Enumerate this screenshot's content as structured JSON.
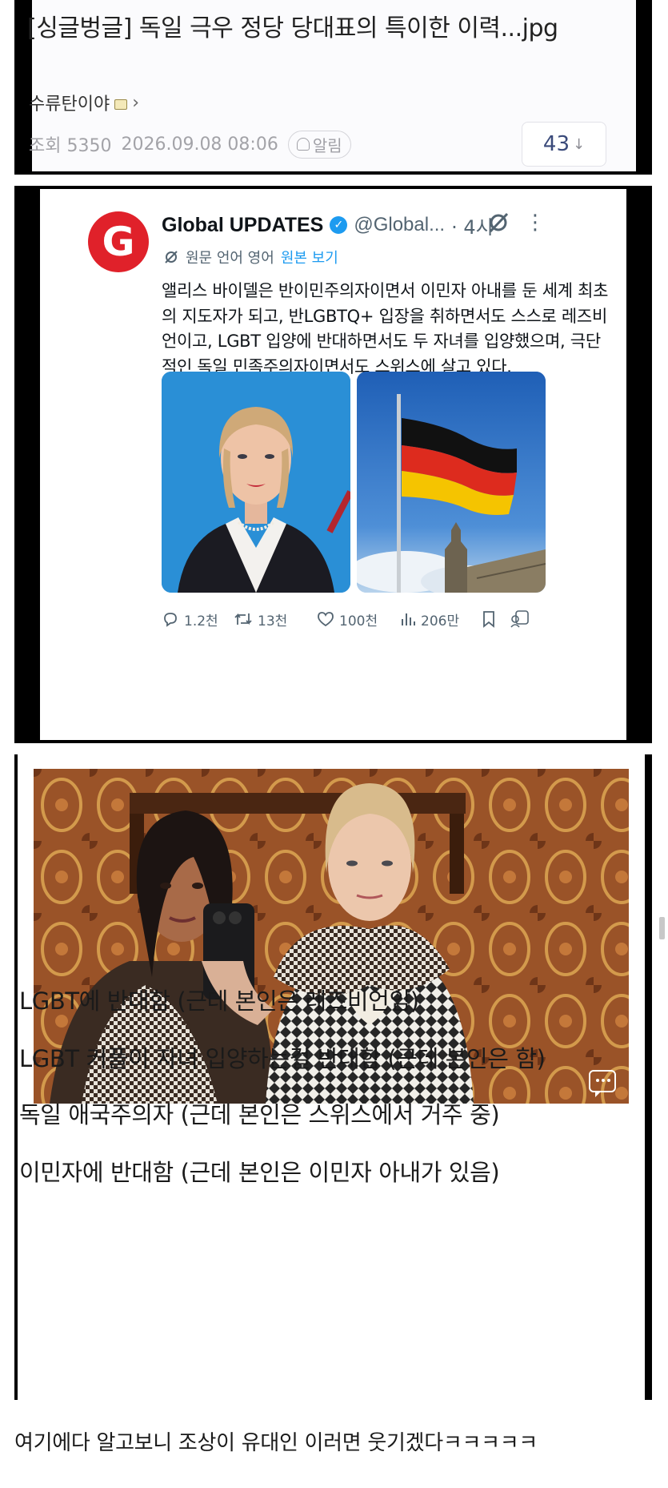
{
  "post": {
    "title": "[싱글벙글] 독일 극우 정당 당대표의 특이한 이력...jpg",
    "author": "수류탄이야",
    "views_label": "조회 5350",
    "datetime": "2026.09.08 08:06",
    "alarm_label": "알림",
    "comment_count": "43"
  },
  "tweet": {
    "display_name": "Global UPDATES",
    "handle": "@Global...",
    "time": "· 4시",
    "translate_note": "원문 언어 영어",
    "show_original": "원본 보기",
    "text": "앨리스 바이델은 반이민주의자이면서 이민자 아내를 둔 세계 최초의 지도자가 되고, 반LGBTQ+ 입장을 취하면서도 스스로 레즈비언이고, LGBT 입양에 반대하면서도 두 자녀를 입양했으며, 극단적인 독일 민족주의자이면서도 스위스에 살고 있다.",
    "replies": "1.2천",
    "retweets": "13천",
    "likes": "100천",
    "views": "206만"
  },
  "summary": [
    "LGBT에 반대함 (근데 본인은 레즈비언임)",
    "LGBT 커플이 자녀 입양하는걸 반대함 (근데 본인은 함)",
    "독일 애국주의자 (근데 본인은 스위스에서 거주 중)",
    "이민자에 반대함 (근데 본인은 이민자 아내가 있음)"
  ],
  "footer_comment": "여기에다 알고보니 조상이 유대인 이러면 웃기겠다ㅋㅋㅋㅋㅋ",
  "colors": {
    "brand_red": "#e0212a",
    "twitter_blue": "#1d9bf0",
    "flag_black": "#111111",
    "flag_red": "#dd2b1e",
    "flag_gold": "#f5c400"
  },
  "icons": [
    "lock-icon",
    "chevron-right-icon",
    "bell-icon",
    "arrow-down-icon",
    "verified-icon",
    "grok-icon",
    "more-icon",
    "reply-icon",
    "retweet-icon",
    "like-icon",
    "views-icon",
    "bookmark-icon",
    "share-icon",
    "comment-bubble-icon"
  ]
}
